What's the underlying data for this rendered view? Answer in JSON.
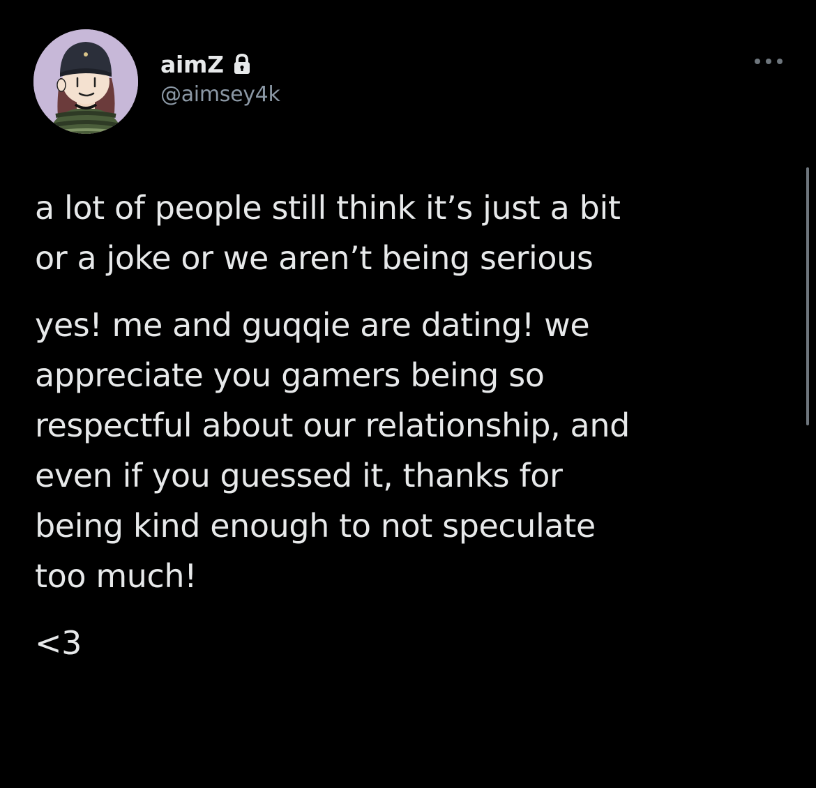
{
  "tweet": {
    "author": {
      "display_name": "aimZ",
      "handle": "@aimsey4k",
      "avatar_icon": "avatar-illustration",
      "protected_icon": "lock-icon"
    },
    "more_icon": "more-dots-icon",
    "paragraphs": [
      "a lot of people still think it’s just a bit\nor a joke or we aren’t being serious",
      "yes! me and guqqie are dating! we\nappreciate you gamers being so\nrespectful about our relationship, and\neven if you guessed it, thanks for\nbeing kind enough to not speculate\ntoo much!",
      "<3"
    ]
  },
  "colors": {
    "background": "#000000",
    "text_primary": "#e7e9ea",
    "text_secondary": "#8b98a5",
    "avatar_bg": "#c7b8d8"
  }
}
